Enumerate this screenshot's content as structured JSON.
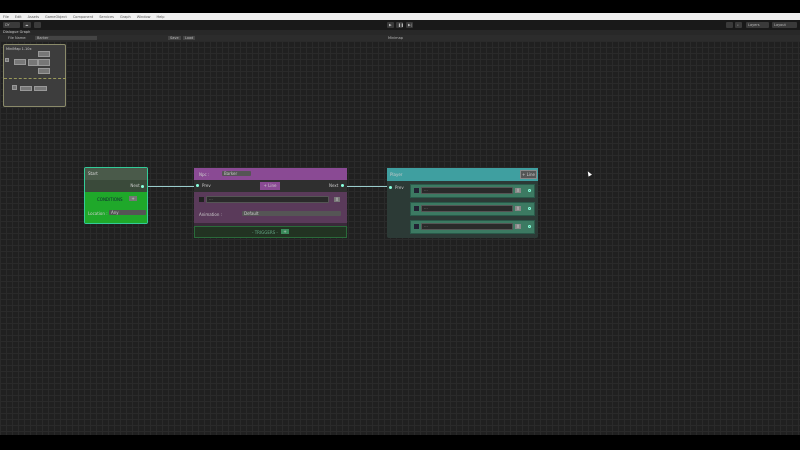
{
  "menu": [
    "File",
    "Edit",
    "Assets",
    "GameObject",
    "Component",
    "Services",
    "Graph",
    "Window",
    "Help"
  ],
  "toolbar": {
    "account": "DY",
    "layers": "Layers",
    "layout": "Layout"
  },
  "window_title": "Dialogue Graph",
  "graph_toolbar": {
    "file_name_label": "File Name:",
    "file_name_value": "Barker",
    "save": "Save",
    "load": "Load",
    "minimap": "Minimap"
  },
  "minimap": {
    "title": "MiniMap 1.10x"
  },
  "start_node": {
    "title": "Start",
    "next": "Next",
    "conditions": "CONDITIONS",
    "add": "+",
    "location_label": "Location :",
    "location_value": "Any"
  },
  "npc_node": {
    "title": "Npc :",
    "npc_value": "Barker",
    "prev": "Prev",
    "add_line": "+ Line",
    "next": "Next",
    "line_text": "...",
    "remove": "X",
    "animation_label": "Animation :",
    "animation_value": "Default",
    "triggers": "- TRIGGERS -",
    "triggers_add": "+"
  },
  "player_node": {
    "title": "Player",
    "add_line": "+ Line",
    "prev": "Prev",
    "lines": [
      {
        "text": "...",
        "remove": "X"
      },
      {
        "text": "...",
        "remove": "X"
      },
      {
        "text": "...",
        "remove": "X"
      }
    ]
  },
  "colors": {
    "start": "#2e7d4a",
    "conditions": "#1fa82a",
    "npc": "#8a4a94",
    "player": "#3f9fa0",
    "canvas": "#202020"
  }
}
